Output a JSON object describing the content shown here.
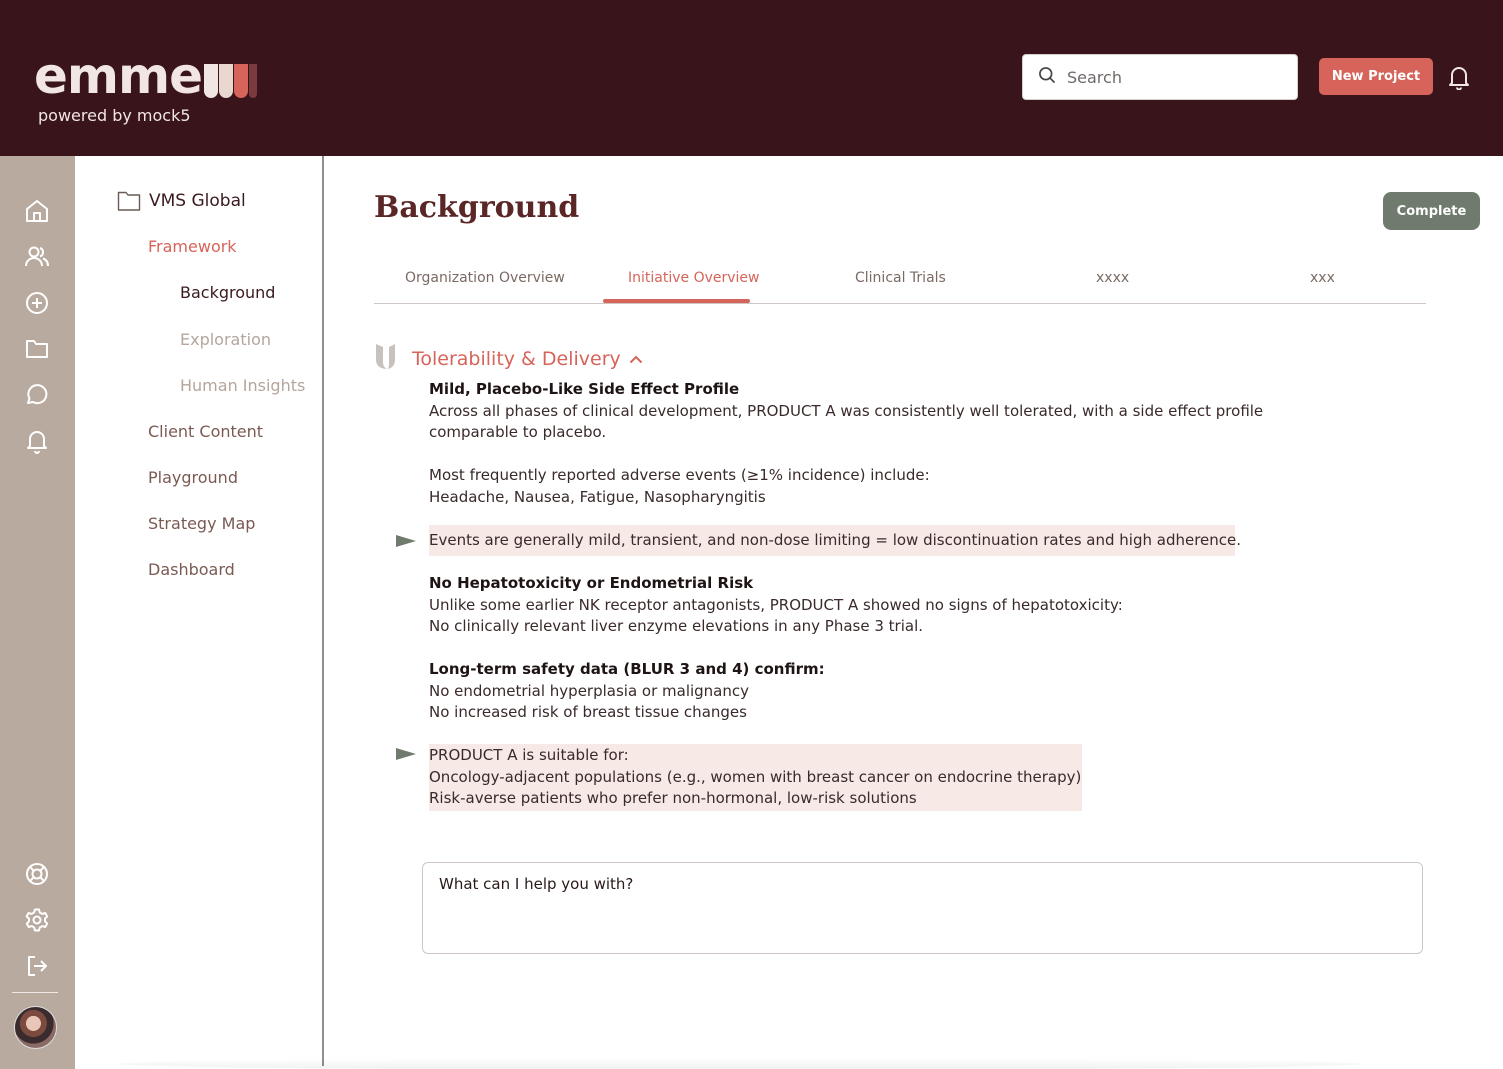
{
  "header": {
    "brand_name": "emme",
    "brand_tagline": "powered by mock5",
    "search_placeholder": "Search",
    "new_project_label": "New Project",
    "colors": {
      "background": "#39141b",
      "accent": "#d7645a",
      "brand_text": "#f1e6e1"
    }
  },
  "rail": {
    "icons": [
      "home-icon",
      "users-icon",
      "add-circle-icon",
      "folder-icon",
      "chat-icon",
      "bell-icon",
      "help-lifebuoy-icon",
      "settings-gear-icon",
      "logout-icon"
    ]
  },
  "nav": {
    "root": "VMS Global",
    "items": [
      {
        "label": "Framework",
        "active": true
      },
      {
        "label": "Background",
        "active": true
      },
      {
        "label": "Exploration"
      },
      {
        "label": "Human Insights"
      },
      {
        "label": "Client Content"
      },
      {
        "label": "Playground"
      },
      {
        "label": "Strategy Map"
      },
      {
        "label": "Dashboard"
      }
    ]
  },
  "main": {
    "title": "Background",
    "complete_label": "Complete",
    "tabs": [
      {
        "label": "Organization Overview"
      },
      {
        "label": "Initiative Overview",
        "active": true
      },
      {
        "label": "Clinical Trials"
      },
      {
        "label": "xxxx"
      },
      {
        "label": "xxx"
      }
    ],
    "section": {
      "heading": "Tolerability & Delivery",
      "lines": {
        "h1": "Mild, Placebo-Like Side Effect Profile",
        "p1a": "Across all phases of clinical development, PRODUCT A was consistently well tolerated, with a side effect profile",
        "p1b": "comparable to placebo.",
        "p2a": "Most frequently reported adverse events (≥1% incidence) include:",
        "p2b": "Headache, Nausea, Fatigue, Nasopharyngitis",
        "callout1": "Events are generally mild, transient, and non-dose limiting = low discontinuation rates and high adherence.",
        "h2": "No Hepatotoxicity or Endometrial Risk",
        "p3a": "Unlike some earlier NK receptor antagonists, PRODUCT A showed no signs of hepatotoxicity:",
        "p3b": "No clinically relevant liver enzyme elevations in any Phase 3 trial.",
        "h3": "Long-term safety data (BLUR 3 and 4) confirm:",
        "p4a": "No endometrial hyperplasia or malignancy",
        "p4b": "No increased risk of breast tissue changes",
        "callout2a": "PRODUCT A is suitable for:",
        "callout2b": "Oncology-adjacent populations (e.g., women with breast cancer on endocrine therapy)",
        "callout2c": "Risk-averse patients who prefer non-hormonal, low-risk solutions"
      }
    },
    "chat_placeholder": "What can I help you with?"
  }
}
